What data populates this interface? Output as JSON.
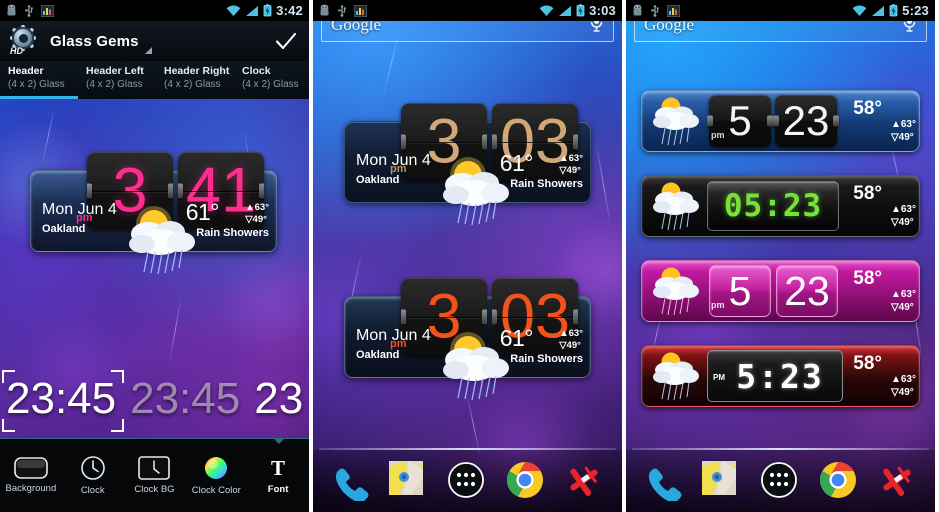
{
  "app": {
    "title": "Glass Gems",
    "icon": "gear-hd-icon",
    "badge": "HD",
    "confirm_label": "check-icon"
  },
  "tabs": [
    {
      "name": "Header",
      "size": "(4 x 2) Glass",
      "active": true
    },
    {
      "name": "Header Left",
      "size": "(4 x 2) Glass",
      "active": false
    },
    {
      "name": "Header Right",
      "size": "(4 x 2) Glass",
      "active": false
    },
    {
      "name": "Clock",
      "size": "(4 x 2) Glass",
      "active": false
    }
  ],
  "panels": [
    {
      "id": "editor",
      "statusbar": {
        "time": "3:42",
        "icons": [
          "android-icon",
          "usb-icon",
          "signal-graph-icon",
          "wifi-icon",
          "cell-signal-icon",
          "battery-charging-icon"
        ]
      }
    },
    {
      "id": "home-orange",
      "statusbar": {
        "time": "3:03",
        "icons": [
          "android-icon",
          "usb-icon",
          "signal-graph-icon",
          "wifi-icon",
          "cell-signal-icon",
          "battery-charging-icon"
        ]
      },
      "search": {
        "label": "Google",
        "mic": "microphone-icon"
      }
    },
    {
      "id": "home-styles",
      "statusbar": {
        "time": "5:23",
        "icons": [
          "android-icon",
          "usb-icon",
          "signal-graph-icon",
          "wifi-icon",
          "cell-signal-icon",
          "battery-charging-icon"
        ]
      },
      "search": {
        "label": "Google",
        "mic": "microphone-icon"
      }
    }
  ],
  "widgets": {
    "editor_preview": {
      "hour": "3",
      "minute": "41",
      "ampm": "pm",
      "date": "Mon Jun 4",
      "city": "Oakland",
      "temp": "61",
      "deg": "°",
      "high": "63°",
      "low": "49°",
      "condition": "Rain Showers",
      "digit_color": "#ff2d8f"
    },
    "home_tan": {
      "hour": "3",
      "minute": "03",
      "ampm": "pm",
      "date": "Mon Jun 4",
      "city": "Oakland",
      "temp": "61",
      "deg": "°",
      "high": "63°",
      "low": "49°",
      "condition": "Rain Showers",
      "digit_color": "#d2a678"
    },
    "home_orange": {
      "hour": "3",
      "minute": "03",
      "ampm": "pm",
      "date": "Mon Jun 4",
      "city": "Oakland",
      "temp": "61",
      "deg": "°",
      "high": "63°",
      "low": "49°",
      "condition": "Rain Showers",
      "digit_color": "#f4521b"
    },
    "blue_flip": {
      "hour": "5",
      "minute": "23",
      "ampm": "pm",
      "temp": "58",
      "deg": "°",
      "high": "63°",
      "low": "49°",
      "digit_color": "#f2f6fa"
    },
    "green_lcd": {
      "time": "05:23",
      "temp": "58",
      "deg": "°",
      "high": "63°",
      "low": "49°",
      "digit_color": "#76e23a"
    },
    "pink_flip": {
      "hour": "5",
      "minute": "23",
      "ampm": "pm",
      "temp": "58",
      "deg": "°",
      "high": "63°",
      "low": "49°",
      "digit_color": "#ffffff"
    },
    "red_lcd": {
      "time": "5:23",
      "ampm": "PM",
      "temp": "58",
      "deg": "°",
      "high": "63°",
      "low": "49°",
      "digit_color": "#ffffff"
    }
  },
  "preview_strip": {
    "items": [
      "23:45",
      "23:45",
      "23"
    ]
  },
  "toolbar": [
    {
      "label": "Background",
      "icon": "rounded-rect-icon",
      "selected": false
    },
    {
      "label": "Clock",
      "icon": "clock-face-icon",
      "selected": false
    },
    {
      "label": "Clock BG",
      "icon": "clock-bg-icon",
      "selected": false
    },
    {
      "label": "Clock Color",
      "icon": "color-wheel-icon",
      "selected": false
    },
    {
      "label": "Font",
      "icon": "letter-t-icon",
      "selected": true
    }
  ],
  "dock": [
    {
      "name": "phone-icon"
    },
    {
      "name": "maps-icon"
    },
    {
      "name": "app-drawer-icon"
    },
    {
      "name": "chrome-icon"
    },
    {
      "name": "plane-icon"
    }
  ],
  "colors": {
    "accent": "#33b5e5",
    "pink": "#ff2d8f",
    "orange": "#f4521b",
    "tan": "#d2a678",
    "green": "#76e23a"
  }
}
